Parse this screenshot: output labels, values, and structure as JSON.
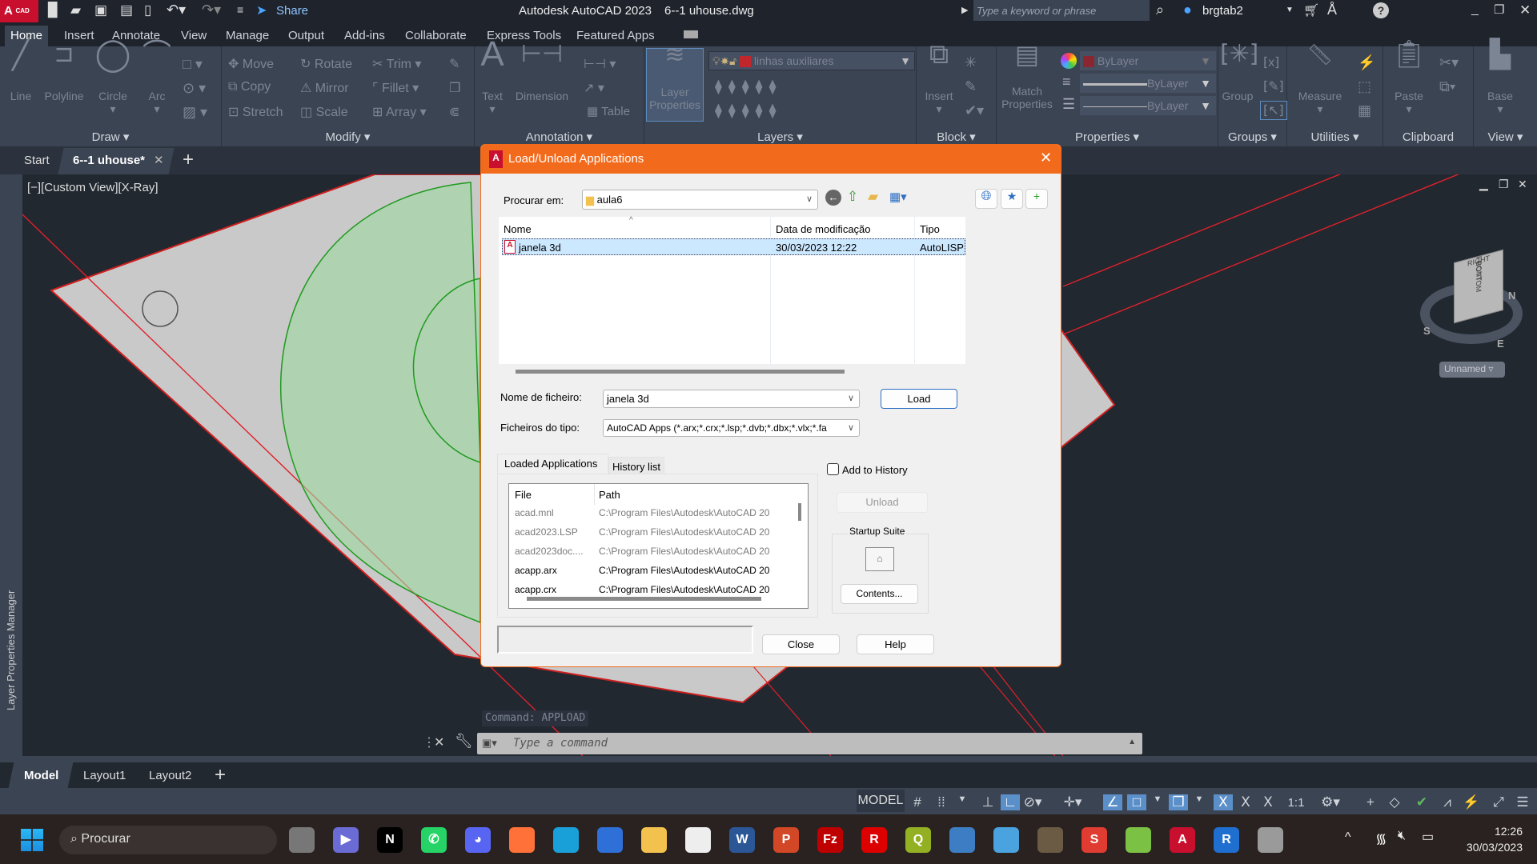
{
  "titlebar": {
    "app_logo": "A",
    "app_logo_sub": "CAD",
    "share_label": "Share",
    "title": "Autodesk AutoCAD 2023",
    "filename": "6--1 uhouse.dwg",
    "search_placeholder": "Type a keyword or phrase",
    "username": "brgtab2",
    "accent": "#c8102e"
  },
  "ribbon_tabs": [
    "Home",
    "Insert",
    "Annotate",
    "View",
    "Manage",
    "Output",
    "Add-ins",
    "Collaborate",
    "Express Tools",
    "Featured Apps"
  ],
  "ribbon": {
    "draw": {
      "label": "Draw",
      "line": "Line",
      "polyline": "Polyline",
      "circle": "Circle",
      "arc": "Arc"
    },
    "modify": {
      "label": "Modify",
      "move": "Move",
      "rotate": "Rotate",
      "trim": "Trim",
      "copy": "Copy",
      "mirror": "Mirror",
      "fillet": "Fillet",
      "stretch": "Stretch",
      "scale": "Scale",
      "array": "Array"
    },
    "annotation": {
      "label": "Annotation",
      "text": "Text",
      "dimension": "Dimension",
      "table": "Table"
    },
    "layers": {
      "label": "Layers",
      "layer_properties": "Layer Properties",
      "current_layer": "linhas auxiliares"
    },
    "block": {
      "label": "Block",
      "insert": "Insert"
    },
    "properties": {
      "label": "Properties",
      "match": "Match Properties",
      "color": "ByLayer",
      "linetype": "ByLayer",
      "lineweight": "ByLayer"
    },
    "groups": {
      "label": "Groups",
      "group": "Group"
    },
    "utilities": {
      "label": "Utilities",
      "measure": "Measure"
    },
    "clipboard": {
      "label": "Clipboard",
      "paste": "Paste"
    },
    "view": {
      "label": "View",
      "base": "Base"
    }
  },
  "file_tabs": {
    "start": "Start",
    "active": "6--1 uhouse*"
  },
  "viewport": {
    "label": "[−][Custom View][X-Ray]",
    "viewcube": {
      "top": "RIGHT",
      "front": "FRONT",
      "side": "BOTTOM",
      "n": "N",
      "s": "S",
      "e": "E"
    },
    "ucs": "Unnamed"
  },
  "palette_label": "Layer Properties Manager",
  "command": {
    "history": "Command: APPLOAD",
    "placeholder": "Type a command"
  },
  "layout_tabs": [
    "Model",
    "Layout1",
    "Layout2"
  ],
  "statusbar": {
    "model": "MODEL",
    "scale": "1:1"
  },
  "dialog": {
    "title": "Load/Unload Applications",
    "look_in_label": "Procurar em:",
    "look_in_value": "aula6",
    "columns": [
      "Nome",
      "Data de modificação",
      "Tipo"
    ],
    "files": [
      {
        "name": "janela 3d",
        "date": "30/03/2023 12:22",
        "type": "AutoLISP"
      }
    ],
    "filename_label": "Nome de ficheiro:",
    "filename_value": "janela 3d",
    "filetype_label": "Ficheiros do tipo:",
    "filetype_value": "AutoCAD Apps (*.arx;*.crx;*.lsp;*.dvb;*.dbx;*.vlx;*.fa",
    "load": "Load",
    "tabs": [
      "Loaded Applications",
      "History list"
    ],
    "add_to_history": "Add to History",
    "add_to_history_checked": false,
    "loaded_columns": [
      "File",
      "Path"
    ],
    "loaded": [
      {
        "file": "acad.mnl",
        "path": "C:\\Program Files\\Autodesk\\AutoCAD 20",
        "dim": true
      },
      {
        "file": "acad2023.LSP",
        "path": "C:\\Program Files\\Autodesk\\AutoCAD 20",
        "dim": true
      },
      {
        "file": "acad2023doc....",
        "path": "C:\\Program Files\\Autodesk\\AutoCAD 20",
        "dim": true
      },
      {
        "file": "acapp.arx",
        "path": "C:\\Program Files\\Autodesk\\AutoCAD 20",
        "dim": false
      },
      {
        "file": "acapp.crx",
        "path": "C:\\Program Files\\Autodesk\\AutoCAD 20",
        "dim": false
      }
    ],
    "unload": "Unload",
    "startup_suite": "Startup Suite",
    "contents": "Contents...",
    "close": "Close",
    "help": "Help",
    "accent": "#f26b1d"
  },
  "taskbar": {
    "search": "Procurar",
    "apps": [
      "task-view",
      "zoom",
      "netflix",
      "whatsapp",
      "discord",
      "firefox",
      "edge",
      "thunderbird",
      "file-explorer",
      "libreoffice",
      "word",
      "powerpoint",
      "filezilla",
      "robot",
      "qgis",
      "virtualbox",
      "paint",
      "gimp",
      "sketchup",
      "vectorworks",
      "autocad",
      "revit",
      "google-earth-pro"
    ],
    "time": "12:26",
    "date": "30/03/2023"
  }
}
